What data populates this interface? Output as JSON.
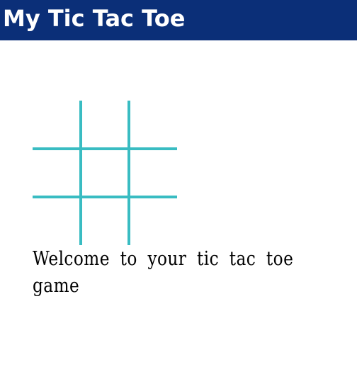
{
  "header": {
    "title": "My Tic Tac Toe"
  },
  "colors": {
    "header_background": "#0b2f78",
    "header_text": "#ffffff",
    "grid_lines": "#39bcc2",
    "page_background": "#ffffff",
    "body_text": "#000000"
  },
  "board": {
    "rows": 3,
    "columns": 3,
    "cells": [
      "",
      "",
      "",
      "",
      "",
      "",
      "",
      "",
      ""
    ]
  },
  "message": {
    "text": "Welcome to your tic tac toe game"
  }
}
